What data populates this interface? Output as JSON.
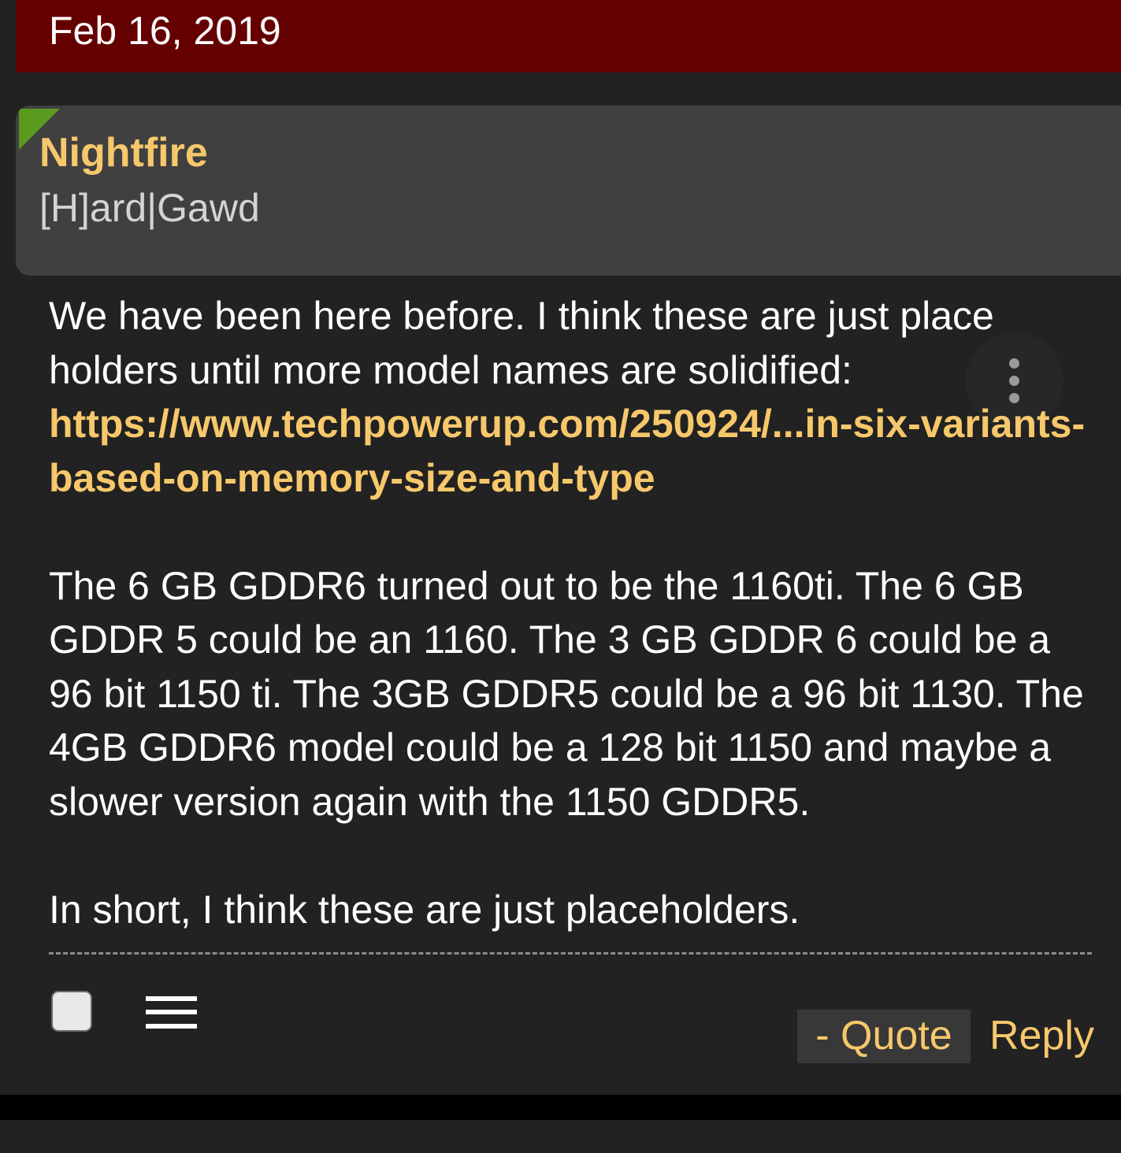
{
  "post": {
    "date": "Feb 16, 2019",
    "author": {
      "name": "Nightfire",
      "title": "[H]ard|Gawd"
    },
    "body": {
      "intro": "We have been here before. I think these are just place holders until more model names are solidified:",
      "link": "https://www.techpowerup.com/250924/...in-six-variants-based-on-memory-size-and-type",
      "paragraph2": "The 6 GB GDDR6 turned out to be the 1160ti. The 6 GB GDDR 5 could be an 1160. The 3 GB GDDR 6 could be a 96 bit 1150 ti. The 3GB GDDR5 could be a 96 bit 1130. The 4GB GDDR6 model could be a 128 bit 1150 and maybe a slower version again with the 1150 GDDR5.",
      "paragraph3": "In short, I think these are just placeholders."
    },
    "actions": {
      "quote_label": "- Quote",
      "reply_label": "Reply"
    }
  },
  "icons": {
    "more": "more-vertical-icon",
    "menu": "hamburger-menu-icon",
    "select": "checkbox-icon"
  },
  "colors": {
    "date_bar": "#650000",
    "accent": "#f7c86b",
    "card": "#404040",
    "background": "#222222",
    "corner_flag": "#5a9a1e"
  }
}
